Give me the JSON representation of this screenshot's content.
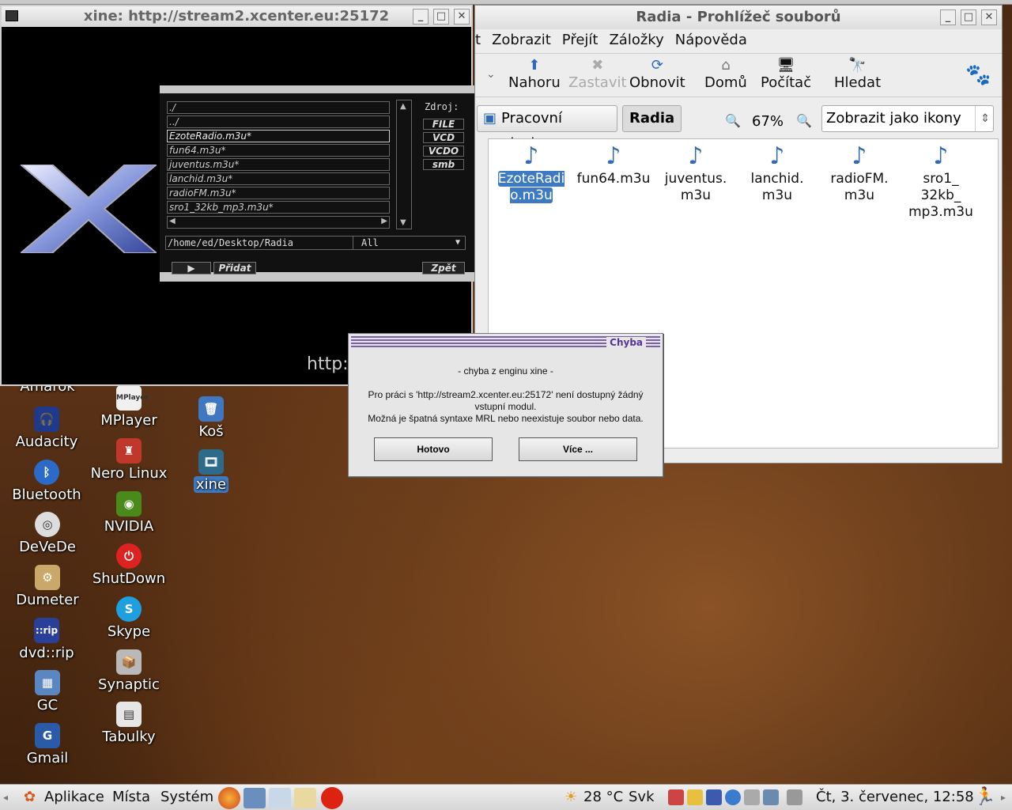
{
  "xine_window": {
    "title": "xine: http://stream2.xcenter.eu:25172",
    "overlay_text": "http:",
    "playlist": {
      "items": [
        "./",
        "../",
        "EzoteRadio.m3u*",
        "fun64.m3u*",
        "juventus.m3u*",
        "lanchid.m3u*",
        "radioFM.m3u*",
        "sro1_32kb_mp3.m3u*"
      ],
      "selected_index": 2,
      "source_label": "Zdroj:",
      "sources": [
        "FILE",
        "VCD",
        "VCDO",
        "smb"
      ],
      "path": "/home/ed/Desktop/Radia",
      "filter": "All",
      "play_label": "▶",
      "add_label": "Přidat",
      "back_label": "Zpět"
    }
  },
  "file_manager": {
    "title": "Radia - Prohlížeč souborů",
    "menu": [
      "t",
      "Zobrazit",
      "Přejít",
      "Záložky",
      "Nápověda"
    ],
    "toolbar": [
      {
        "label": "Nahoru",
        "icon": "⬆",
        "enabled": true
      },
      {
        "label": "Zastavit",
        "icon": "✖",
        "enabled": false
      },
      {
        "label": "Obnovit",
        "icon": "⟳",
        "enabled": true
      },
      {
        "label": "Domů",
        "icon": "⌂",
        "enabled": true
      },
      {
        "label": "Počítač",
        "icon": "🖥",
        "enabled": true
      },
      {
        "label": "Hledat",
        "icon": "🔭",
        "enabled": true
      }
    ],
    "location": [
      "Pracovní plocha",
      "Radia"
    ],
    "zoom": "67%",
    "view_mode": "Zobrazit jako ikony",
    "files": [
      {
        "name": "EzoteRadi o.m3u",
        "sel": true
      },
      {
        "name": "fun64.m3u"
      },
      {
        "name": "juventus. m3u"
      },
      {
        "name": "lanchid. m3u"
      },
      {
        "name": "radioFM. m3u"
      },
      {
        "name": "sro1_ 32kb_ mp3.m3u"
      }
    ]
  },
  "dialog": {
    "title": "Chyba",
    "heading": "- chyba z enginu xine -",
    "line1": "Pro práci s 'http://stream2.xcenter.eu:25172' není dostupný žádný",
    "line2": "vstupní modul.",
    "line3": "Možná je špatná syntaxe MRL nebo neexistuje soubor nebo data.",
    "ok": "Hotovo",
    "more": "Více ..."
  },
  "desktop_icons": [
    {
      "label": "Amarok",
      "icon": "amarok-icon"
    },
    {
      "label": "Audacity",
      "icon": "audacity-icon"
    },
    {
      "label": "Bluetooth",
      "icon": "bluetooth-icon"
    },
    {
      "label": "DeVeDe",
      "icon": "devede-icon"
    },
    {
      "label": "Dumeter",
      "icon": "dumeter-icon"
    },
    {
      "label": "dvd::rip",
      "icon": "dvdrip-icon"
    },
    {
      "label": "GC",
      "icon": "gc-icon"
    },
    {
      "label": "Gmail",
      "icon": "gmail-icon"
    },
    {
      "label": "MPlayer",
      "icon": "mplayer-icon"
    },
    {
      "label": "Nero Linux",
      "icon": "nero-icon"
    },
    {
      "label": "NVIDIA",
      "icon": "nvidia-icon"
    },
    {
      "label": "ShutDown",
      "icon": "shutdown-icon"
    },
    {
      "label": "Skype",
      "icon": "skype-icon"
    },
    {
      "label": "Synaptic",
      "icon": "synaptic-icon"
    },
    {
      "label": "Tabulky",
      "icon": "spreadsheet-icon"
    },
    {
      "label": "Koš",
      "icon": "trash-icon"
    },
    {
      "label": "xine",
      "icon": "xine-icon"
    }
  ],
  "panel": {
    "menus": [
      "Aplikace",
      "Místa",
      "Systém"
    ],
    "weather": "28 °C",
    "layout": "Svk",
    "datetime": "Čt,  3. červenec, 12:58"
  }
}
